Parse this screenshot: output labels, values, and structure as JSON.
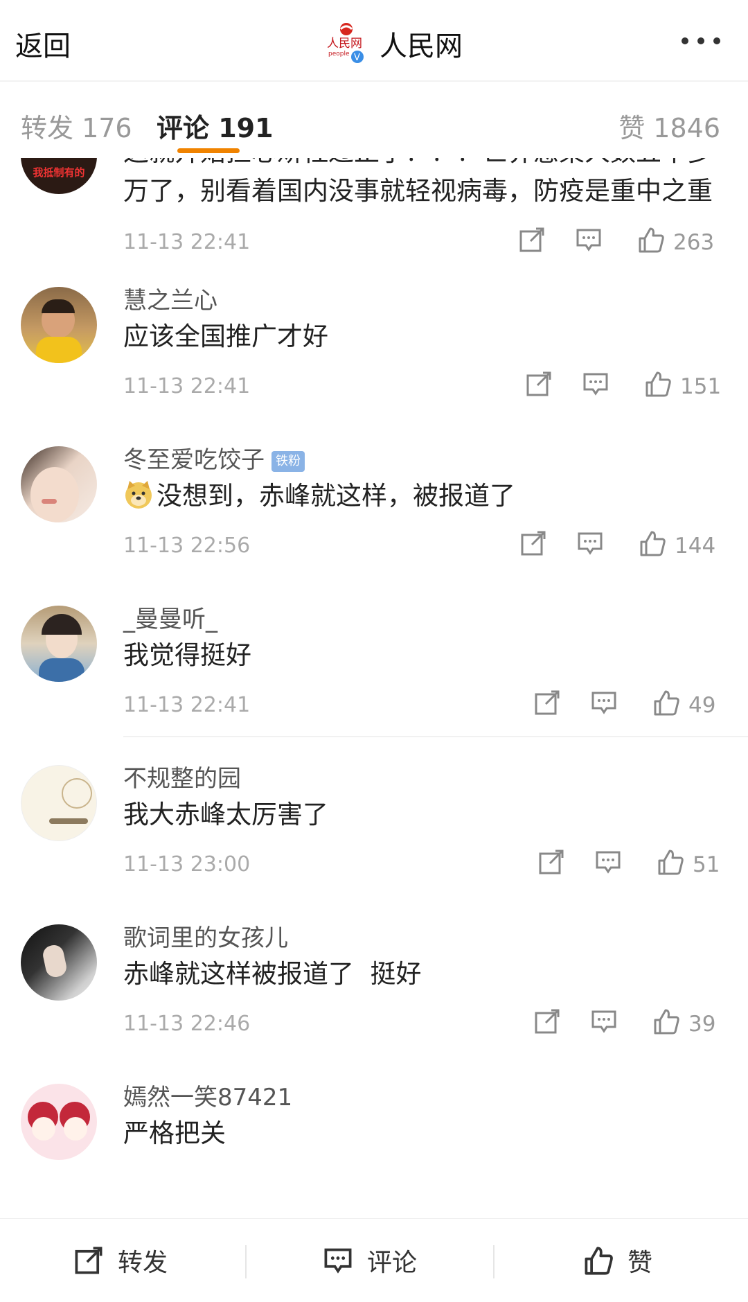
{
  "header": {
    "back_label": "返回",
    "title": "人民网",
    "logo_text": "人民网",
    "logo_sub": "people",
    "more_icon": "ellipsis-icon"
  },
  "tabs": [
    {
      "label": "转发 176",
      "active": false
    },
    {
      "label": "评论 191",
      "active": true
    },
    {
      "label": "赞 1846",
      "active": false
    }
  ],
  "accent_color": "#f08300",
  "comments": [
    {
      "name": "",
      "badge": "",
      "emoji": false,
      "text": "这就开始担心矫枉过正了？？？世界感染人数五千多万了，别看着国内没事就轻视病毒，防疫是重中之重",
      "time": "11-13 22:41",
      "likes": "263",
      "avatar_caption": "我抵制有的"
    },
    {
      "name": "慧之兰心",
      "badge": "",
      "emoji": false,
      "text": "应该全国推广才好",
      "time": "11-13 22:41",
      "likes": "151"
    },
    {
      "name": "冬至爱吃饺子",
      "badge": "铁粉",
      "emoji": true,
      "text": "没想到，赤峰就这样，被报道了",
      "time": "11-13 22:56",
      "likes": "144"
    },
    {
      "name": "_曼曼听_",
      "badge": "",
      "emoji": false,
      "text": "我觉得挺好",
      "time": "11-13 22:41",
      "likes": "49"
    },
    {
      "name": "不规整的园",
      "badge": "",
      "emoji": false,
      "text": "我大赤峰太厉害了",
      "time": "11-13 23:00",
      "likes": "51"
    },
    {
      "name": "歌词里的女孩儿",
      "badge": "",
      "emoji": false,
      "text": "赤峰就这样被报道了  挺好",
      "time": "11-13 22:46",
      "likes": "39"
    },
    {
      "name": "嫣然一笑87421",
      "badge": "",
      "emoji": false,
      "text": "严格把关",
      "time": "",
      "likes": ""
    }
  ],
  "bottom_bar": {
    "repost_label": "转发",
    "comment_label": "评论",
    "like_label": "赞"
  }
}
